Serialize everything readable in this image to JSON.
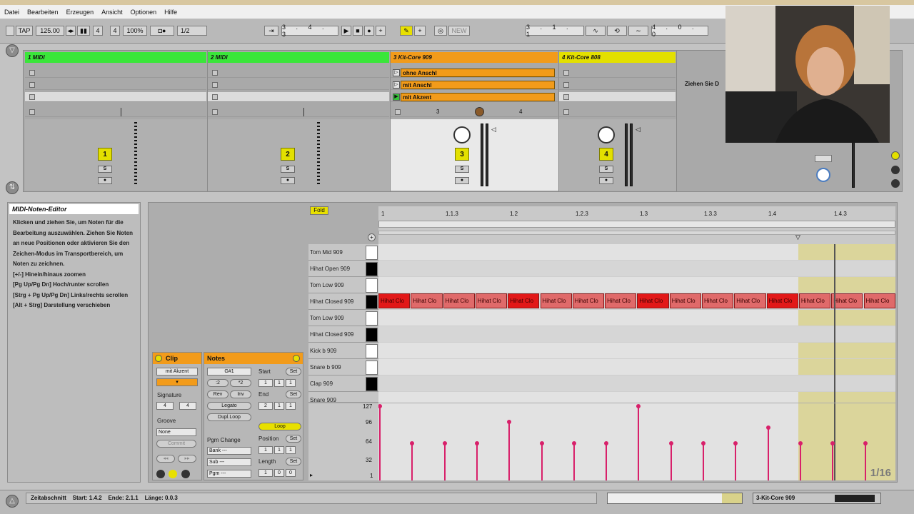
{
  "menu": [
    "Datei",
    "Bearbeiten",
    "Erzeugen",
    "Ansicht",
    "Optionen",
    "Hilfe"
  ],
  "transport": {
    "tap": "TAP",
    "tempo": "125.00",
    "sig_num": "4",
    "sig_den": "4",
    "zoom": "100%",
    "quant": "1/2",
    "position": "3 . 4 . 3",
    "new": "NEW",
    "loop_start": "3 . 1 . 1",
    "loop_len": "4 . 0 . 0"
  },
  "tracks": [
    {
      "name": "1 MIDI",
      "num": "1",
      "color": "#3ae63a"
    },
    {
      "name": "2 MIDI",
      "num": "2",
      "color": "#3ae63a"
    },
    {
      "name": "3 Kit-Core 909",
      "num": "3",
      "color": "#f29b1a"
    },
    {
      "name": "4 Kit-Core 808",
      "num": "4",
      "color": "#e3e000"
    }
  ],
  "clips": [
    "ohne Anschl",
    "mit Anschl",
    "mit Akzent"
  ],
  "solo_label": "S",
  "send_labels": [
    "3",
    "4"
  ],
  "drop_hint": "Ziehen Sie D",
  "info": {
    "title": "MIDI-Noten-Editor",
    "body": "Klicken und ziehen Sie, um Noten für die Bearbeitung auszuwählen. Ziehen Sie Noten an neue Positionen oder aktivieren Sie den Zeichen-Modus im Transportbereich, um Noten zu zeichnen.\n[+/-] Hinein/hinaus zoomen\n[Pg Up/Pg Dn] Hoch/runter scrollen\n[Strg + Pg Up/Pg Dn] Links/rechts scrollen\n[Alt + Strg] Darstellung verschieben"
  },
  "clipbox": {
    "title": "Clip",
    "name": "mit Akzent",
    "signature": "Signature",
    "sig_num": "4",
    "sig_den": "4",
    "groove": "Groove",
    "groove_val": "None",
    "commit": "Commit"
  },
  "notesbox": {
    "title": "Notes",
    "key": "G#1",
    "half": ":2",
    "double": "*2",
    "rev": "Rev",
    "inv": "Inv",
    "legato": "Legato",
    "dupl": "Dupl.Loop",
    "start": "Start",
    "end": "End",
    "set": "Set",
    "loop": "Loop",
    "position": "Position",
    "length": "Length",
    "pgm": "Pgm Change",
    "bank": "Bank ---",
    "sub": "Sub ---",
    "pgm_field": "Pgm ---",
    "start_vals": [
      "1",
      "1",
      "1"
    ],
    "end_vals": [
      "2",
      "1",
      "1"
    ],
    "pos_vals": [
      "1",
      "1",
      "1"
    ],
    "len_vals": [
      "1",
      "0",
      "0"
    ]
  },
  "fold": "Fold",
  "ruler": [
    "1",
    "1.1.3",
    "1.2",
    "1.2.3",
    "1.3",
    "1.3.3",
    "1.4",
    "1.4.3"
  ],
  "keys": [
    {
      "name": "Tom Mid 909",
      "black": false
    },
    {
      "name": "Hihat Open 909",
      "black": true
    },
    {
      "name": "Tom Low 909",
      "black": false
    },
    {
      "name": "Hihat Closed 909",
      "black": true
    },
    {
      "name": "Tom Low 909",
      "black": false
    },
    {
      "name": "Hihat Closed 909",
      "black": true
    },
    {
      "name": "Kick b 909",
      "black": false
    },
    {
      "name": "Snare b 909",
      "black": false
    },
    {
      "name": "Clap 909",
      "black": true
    },
    {
      "name": "Snare 909",
      "black": false
    }
  ],
  "note_label": "Hihat Clo",
  "notes": [
    {
      "step": 0,
      "vel": 127,
      "hi": true
    },
    {
      "step": 1,
      "vel": 64,
      "hi": false
    },
    {
      "step": 2,
      "vel": 64,
      "hi": false
    },
    {
      "step": 3,
      "vel": 64,
      "hi": false
    },
    {
      "step": 4,
      "vel": 100,
      "hi": true
    },
    {
      "step": 5,
      "vel": 64,
      "hi": false
    },
    {
      "step": 6,
      "vel": 64,
      "hi": false
    },
    {
      "step": 7,
      "vel": 64,
      "hi": false
    },
    {
      "step": 8,
      "vel": 127,
      "hi": true
    },
    {
      "step": 9,
      "vel": 64,
      "hi": false
    },
    {
      "step": 10,
      "vel": 64,
      "hi": false
    },
    {
      "step": 11,
      "vel": 64,
      "hi": false
    },
    {
      "step": 12,
      "vel": 90,
      "hi": true
    },
    {
      "step": 13,
      "vel": 64,
      "hi": false
    },
    {
      "step": 14,
      "vel": 64,
      "hi": false
    },
    {
      "step": 15,
      "vel": 64,
      "hi": false
    }
  ],
  "vel_ticks": [
    "127",
    "96",
    "64",
    "32",
    "1"
  ],
  "grid_label": "1/16",
  "status": {
    "zeit": "Zeitabschnitt",
    "start": "Start: 1.4.2",
    "ende": "Ende: 2.1.1",
    "laenge": "Länge: 0.0.3",
    "device": "3-Kit-Core 909"
  }
}
